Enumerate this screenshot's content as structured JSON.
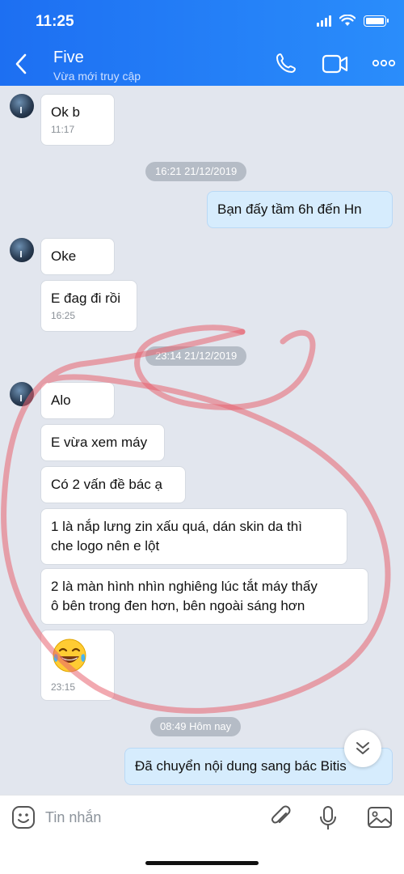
{
  "status_bar": {
    "time": "11:25"
  },
  "header": {
    "contact_name": "Five",
    "contact_status": "Vừa mới truy cập"
  },
  "messages": [
    {
      "text": "Ok b",
      "time": "11:17"
    },
    {
      "date": "16:21 21/12/2019"
    },
    {
      "text": "Bạn đấy tầm 6h đến Hn"
    },
    {
      "text": "Oke"
    },
    {
      "text": "E đag đi rồi",
      "time": "16:25"
    },
    {
      "date": "23:14 21/12/2019"
    },
    {
      "text": "Alo"
    },
    {
      "text": "E vừa xem máy"
    },
    {
      "text": "Có 2 vấn đề bác ạ"
    },
    {
      "line1": "1 là nắp lưng zin xấu quá, dán skin da thì",
      "line2": "che logo nên e lột"
    },
    {
      "line1": "2 là màn hình nhìn nghiêng lúc tắt máy thấy",
      "line2": "ô bên trong đen hơn, bên ngoài sáng hơn"
    },
    {
      "emoji": "laughing-tears-emoji",
      "time": "23:15"
    },
    {
      "date": "08:49 Hôm nay"
    },
    {
      "text": "Đã chuyển nội dung sang bác Bitis"
    }
  ],
  "input": {
    "placeholder": "Tin nhắn"
  },
  "colors": {
    "header": "#1d6ff2",
    "outgoing_bubble": "#d6ecfd",
    "annotation": "#e8626f"
  }
}
